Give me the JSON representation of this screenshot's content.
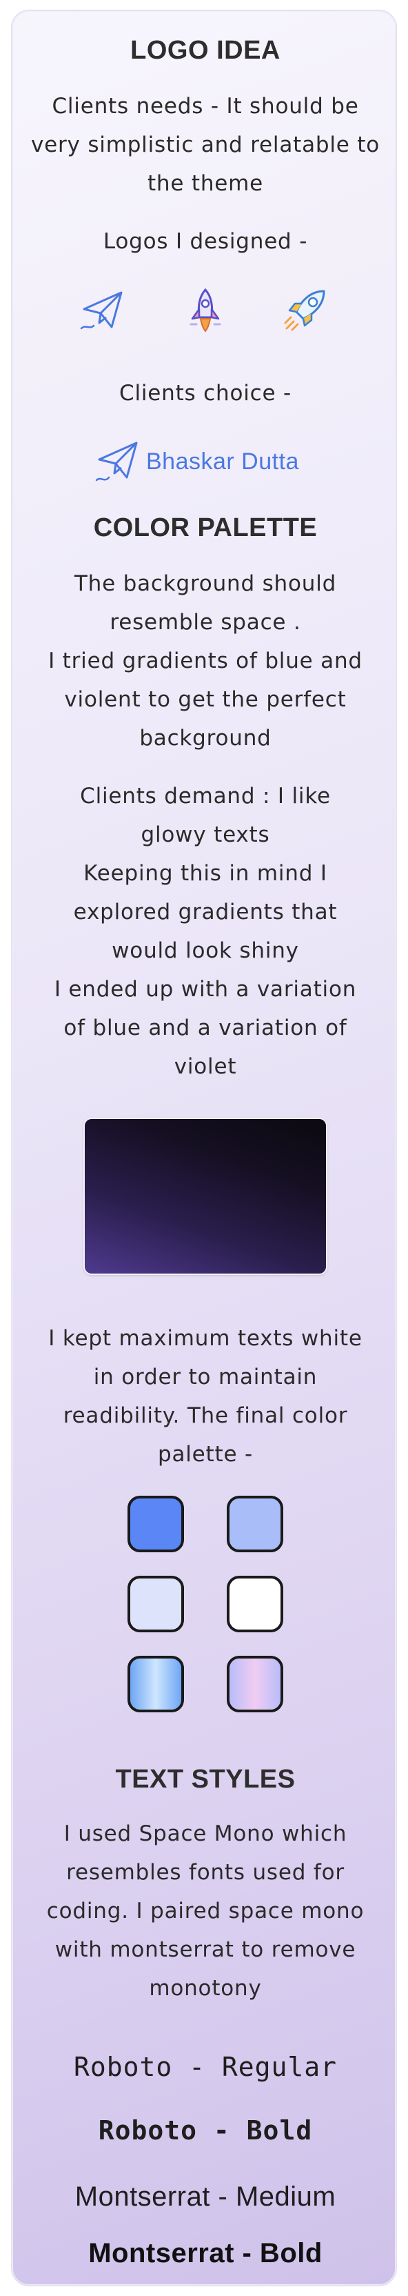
{
  "logo_section": {
    "heading": "LOGO IDEA",
    "needs": "Clients needs - It should be very simplistic and relatable to the theme",
    "designed_label": "Logos I designed -",
    "icons": [
      "paper-plane-icon",
      "shuttle-icon",
      "rocket-icon"
    ],
    "choice_label": "Clients choice -",
    "chosen_logo_text": "Bhaskar Dutta"
  },
  "color_section": {
    "heading": "COLOR PALETTE",
    "p1_lines": [
      "The background should",
      "resemble space .",
      "I tried gradients of blue and",
      "violent to get the perfect",
      "background"
    ],
    "p2_lines": [
      "Clients demand : I like",
      "glowy texts",
      "Keeping this in mind I",
      "explored gradients that",
      "would look shiny",
      "I ended up with a variation",
      "of blue and a variation of",
      "violet"
    ],
    "p3_lines": [
      "I kept maximum texts white",
      "in order to maintain",
      "readibility. The final color",
      "palette -"
    ],
    "background_gradient": [
      "#4e3a8f",
      "#150f22",
      "#0b0910"
    ],
    "swatches": [
      {
        "name": "blue",
        "color": "#5b86f5"
      },
      {
        "name": "light-blue",
        "color": "#a9bdf8"
      },
      {
        "name": "pale-blue",
        "color": "#dce3fb"
      },
      {
        "name": "white",
        "color": "#ffffff"
      },
      {
        "name": "blue-gradient",
        "from": "#6fa6f4",
        "to": "#cfe6ff"
      },
      {
        "name": "violet-gradient",
        "from": "#b9bcf9",
        "to": "#f0cdf3"
      }
    ]
  },
  "text_section": {
    "heading": "TEXT STYLES",
    "para_lines": [
      "I used Space Mono which",
      "resembles fonts used for",
      "coding. I paired space mono",
      "with montserrat to remove",
      "monotony"
    ],
    "samples": {
      "mono_regular": "Roboto - Regular",
      "mono_bold": "Roboto - Bold",
      "sans_medium": "Montserrat - Medium",
      "sans_bold": "Montserrat - Bold"
    }
  }
}
